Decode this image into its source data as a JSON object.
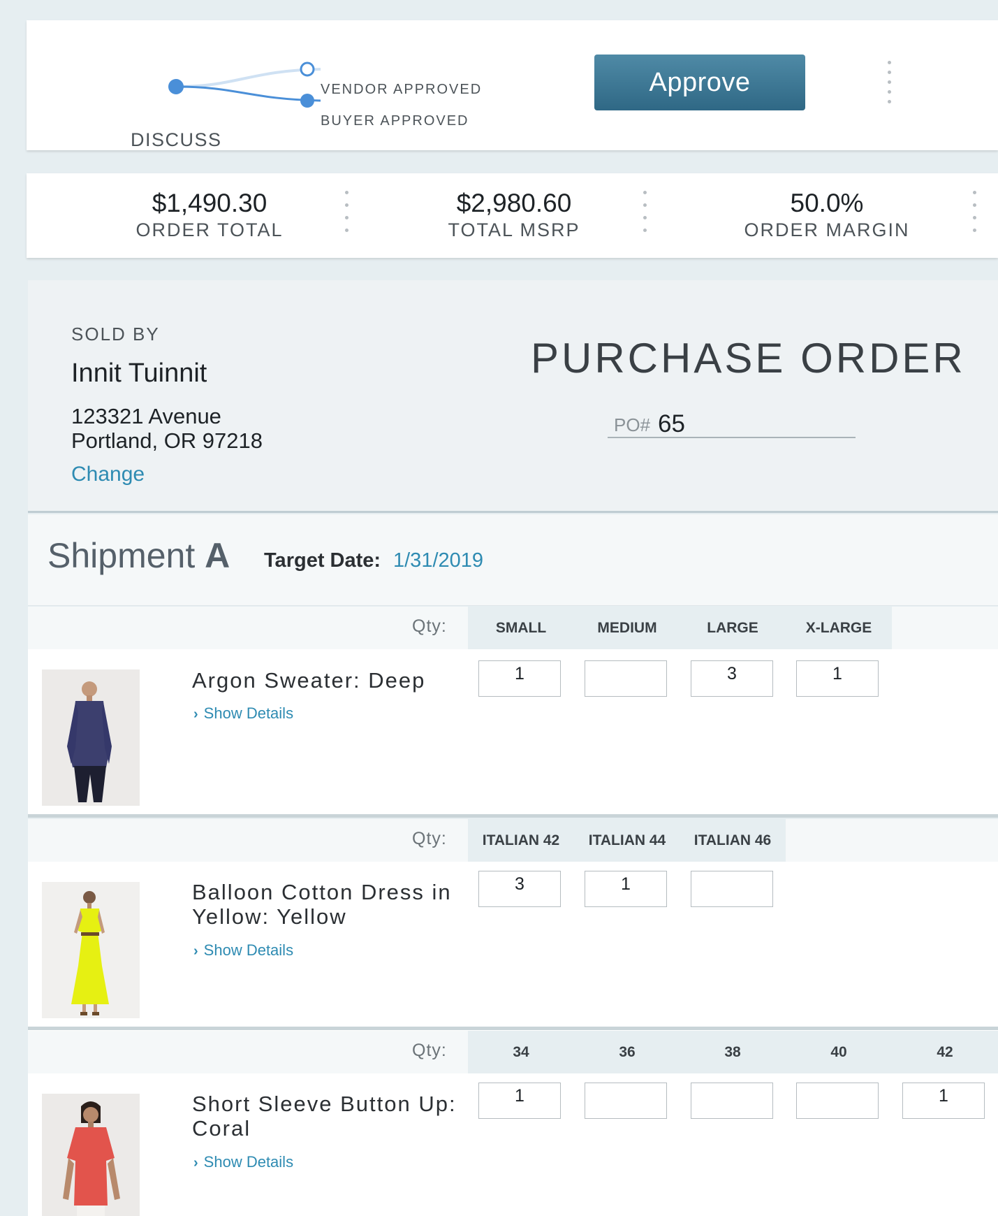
{
  "workflow": {
    "discuss_label": "DISCUSS",
    "vendor_approved_label": "VENDOR APPROVED",
    "buyer_approved_label": "BUYER APPROVED",
    "approve_button": "Approve"
  },
  "totals": [
    {
      "amount": "$1,490.30",
      "caption": "ORDER TOTAL"
    },
    {
      "amount": "$2,980.60",
      "caption": "TOTAL MSRP"
    },
    {
      "amount": "50.0%",
      "caption": "ORDER MARGIN"
    }
  ],
  "seller": {
    "sold_by_label": "SOLD BY",
    "name": "Innit Tuinnit",
    "address_line1": "123321 Avenue",
    "address_line2": "Portland, OR 97218",
    "change_link": "Change"
  },
  "purchase_order": {
    "title": "PURCHASE ORDER",
    "po_label": "PO#",
    "po_number": "65"
  },
  "shipment": {
    "title_prefix": "Shipment",
    "letter": "A",
    "target_label": "Target Date:",
    "target_date": "1/31/2019"
  },
  "products": [
    {
      "qty_label": "Qty:",
      "name_line1": "Argon Sweater: Deep",
      "name_line2": "",
      "details_link": "Show Details",
      "sizes": [
        "SMALL",
        "MEDIUM",
        "LARGE",
        "X-LARGE"
      ],
      "quantities": [
        "1",
        "",
        "3",
        "1"
      ]
    },
    {
      "qty_label": "Qty:",
      "name_line1": "Balloon Cotton Dress in",
      "name_line2": "Yellow: Yellow",
      "details_link": "Show Details",
      "sizes": [
        "ITALIAN 42",
        "ITALIAN 44",
        "ITALIAN 46"
      ],
      "quantities": [
        "3",
        "1",
        ""
      ]
    },
    {
      "qty_label": "Qty:",
      "name_line1": "Short Sleeve Button Up:",
      "name_line2": "Coral",
      "details_link": "Show Details",
      "sizes": [
        "34",
        "36",
        "38",
        "40",
        "42"
      ],
      "quantities": [
        "1",
        "",
        "",
        "",
        "1"
      ]
    }
  ],
  "colors": {
    "accent_link": "#2e8bb2",
    "approve_button": "#3a7796",
    "flow_line": "#4a8fd8",
    "page_background": "#e6eef1"
  },
  "icons": {
    "show_details": "chevron-right-icon",
    "more_menu": "vertical-dots-icon"
  }
}
